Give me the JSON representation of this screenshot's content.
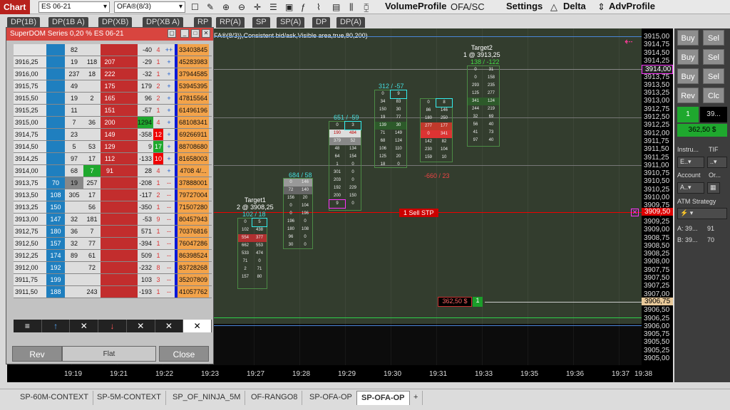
{
  "toolbar": {
    "chart_label": "Chart",
    "instrument": "ES 06-21",
    "dataseries": "OFA®(8/3)",
    "volumeprofile": "VolumeProfile",
    "ofa_sc": "OFA/SC",
    "settings": "Settings",
    "delta": "Delta",
    "advprofile": "AdvProfile"
  },
  "subtabs": [
    "DP(1B)",
    "DP(1B A)",
    "DP(XB)",
    "DP(XB A)",
    "RP",
    "RP(A)",
    "SP",
    "SP(A)",
    "DP",
    "DP(A)"
  ],
  "chart_info": "FA®(8/3)),Consistent bid/ask,Visible area,true,80,200)",
  "yaxis": [
    "3915,00",
    "3914,75",
    "3914,50",
    "3914,25",
    "3914,00",
    "3913,75",
    "3913,50",
    "3913,25",
    "3913,00",
    "3912,75",
    "3912,50",
    "3912,25",
    "3912,00",
    "3911,75",
    "3911,50",
    "3911,25",
    "3911,00",
    "3910,75",
    "3910,50",
    "3910,25",
    "3910,00",
    "3909,75",
    "3909,50",
    "3909,25",
    "3909,00",
    "3908,75",
    "3908,50",
    "3908,25",
    "3908,00",
    "3907,75",
    "3907,50",
    "3907,25",
    "3907,00",
    "3906,75",
    "3906,50",
    "3906,25",
    "3906,00",
    "3905,75",
    "3905,50",
    "3905,25",
    "3905,00"
  ],
  "xaxis": [
    "19:19",
    "19:21",
    "19:22",
    "19:23",
    "19:27",
    "19:28",
    "19:29",
    "19:30",
    "19:31",
    "19:33",
    "19:35",
    "19:36",
    "19:37",
    "19:38"
  ],
  "price_tags": {
    "top": "3914,00",
    "stp": "3909,50",
    "mid": "3906,75"
  },
  "stp_label": "1  Sell STP",
  "targets": {
    "t1": "Target1",
    "t1_sub": "2 @ 3908,25",
    "t2": "Target2",
    "t2_sub": "1 @ 3913,25"
  },
  "pnl": "362,50 $",
  "pnl_qty": "1",
  "cluster_sums": [
    {
      "d": "102 / 18"
    },
    {
      "d": "684 / 58"
    },
    {
      "d": "651 / -59"
    },
    {
      "d": "312 / -57"
    },
    {
      "d": "-660 / 23"
    },
    {
      "d": "138 / -122"
    }
  ],
  "superdom": {
    "title": "SuperDOM Series 0,20 % ES 06-21",
    "rows": [
      [
        "",
        "",
        "82",
        "",
        "",
        "",
        "-40",
        "4",
        "++",
        "33403845"
      ],
      [
        "3916,25",
        "",
        "19",
        "118",
        "207",
        "",
        "-29",
        "1",
        "+",
        "45283983"
      ],
      [
        "3916,00",
        "",
        "237",
        "18",
        "222",
        "",
        "-32",
        "1",
        "+",
        "37944585"
      ],
      [
        "3915,75",
        "",
        "49",
        "",
        "175",
        "",
        "179",
        "2",
        "+",
        "53945395"
      ],
      [
        "3915,50",
        "",
        "19",
        "2",
        "165",
        "",
        "96",
        "2",
        "+",
        "47815564"
      ],
      [
        "3915,25",
        "",
        "11",
        "",
        "151",
        "",
        "-57",
        "1",
        "+",
        "61496196"
      ],
      [
        "3915,00",
        "",
        "7",
        "36",
        "200",
        "",
        "1294",
        "4",
        "+",
        "68108341"
      ],
      [
        "3914,75",
        "",
        "23",
        "",
        "149",
        "",
        "-358",
        "12",
        "+",
        "69266911"
      ],
      [
        "3914,50",
        "",
        "5",
        "53",
        "129",
        "",
        "9",
        "17",
        "+",
        "88708680"
      ],
      [
        "3914,25",
        "",
        "97",
        "17",
        "112",
        "",
        "-133",
        "10",
        "+",
        "81658003"
      ],
      [
        "3914,00",
        "",
        "68",
        "7",
        "91",
        "",
        "28",
        "4",
        "+",
        "4708 4/..."
      ],
      [
        "3913,75",
        "70",
        "19",
        "257",
        "",
        "",
        "-208",
        "1",
        "--",
        "37888001"
      ],
      [
        "3913,50",
        "108",
        "305",
        "17",
        "",
        "",
        "-117",
        "2",
        "--",
        "79727004"
      ],
      [
        "3913,25",
        "150",
        "",
        "56",
        "",
        "",
        "-350",
        "1",
        "--",
        "71507280"
      ],
      [
        "3913,00",
        "147",
        "32",
        "181",
        "",
        "",
        "-53",
        "9",
        "--",
        "80457943"
      ],
      [
        "3912,75",
        "180",
        "36",
        "7",
        "",
        "",
        "571",
        "1",
        "--",
        "70376816"
      ],
      [
        "3912,50",
        "157",
        "32",
        "77",
        "",
        "",
        "-394",
        "1",
        "--",
        "76047286"
      ],
      [
        "3912,25",
        "174",
        "89",
        "61",
        "",
        "",
        "509",
        "1",
        "--",
        "86398524"
      ],
      [
        "3912,00",
        "192",
        "",
        "72",
        "",
        "",
        "-232",
        "8",
        "--",
        "83728268"
      ],
      [
        "3911,75",
        "199",
        "",
        "",
        "",
        "",
        "103",
        "3",
        "--",
        "35207809"
      ],
      [
        "3911,50",
        "188",
        "",
        "243",
        "",
        "",
        "-193",
        "1",
        "--",
        "41057762"
      ]
    ],
    "rev": "Rev",
    "flat": "Flat",
    "close": "Close"
  },
  "rpanel": {
    "buy": "Buy",
    "sell": "Sel",
    "rev": "Rev",
    "clc": "Clc",
    "qty": "1",
    "price": "39...",
    "pnl": "362,50 $",
    "instrument": "Instru...",
    "tif": "TIF",
    "account": "Account",
    "or": "Or...",
    "atm": "ATM Strategy",
    "a": "A:  39...",
    "a_v": "91",
    "b": "B:  39...",
    "b_v": "70"
  },
  "bottom_tabs": [
    "SP-60M-CONTEXT",
    "SP-5M-CONTEXT",
    "SP_OF_NINJA_5M",
    "OF-RANGO8",
    "SP-OFA-OP",
    "SP-OFA-OP",
    "+"
  ]
}
